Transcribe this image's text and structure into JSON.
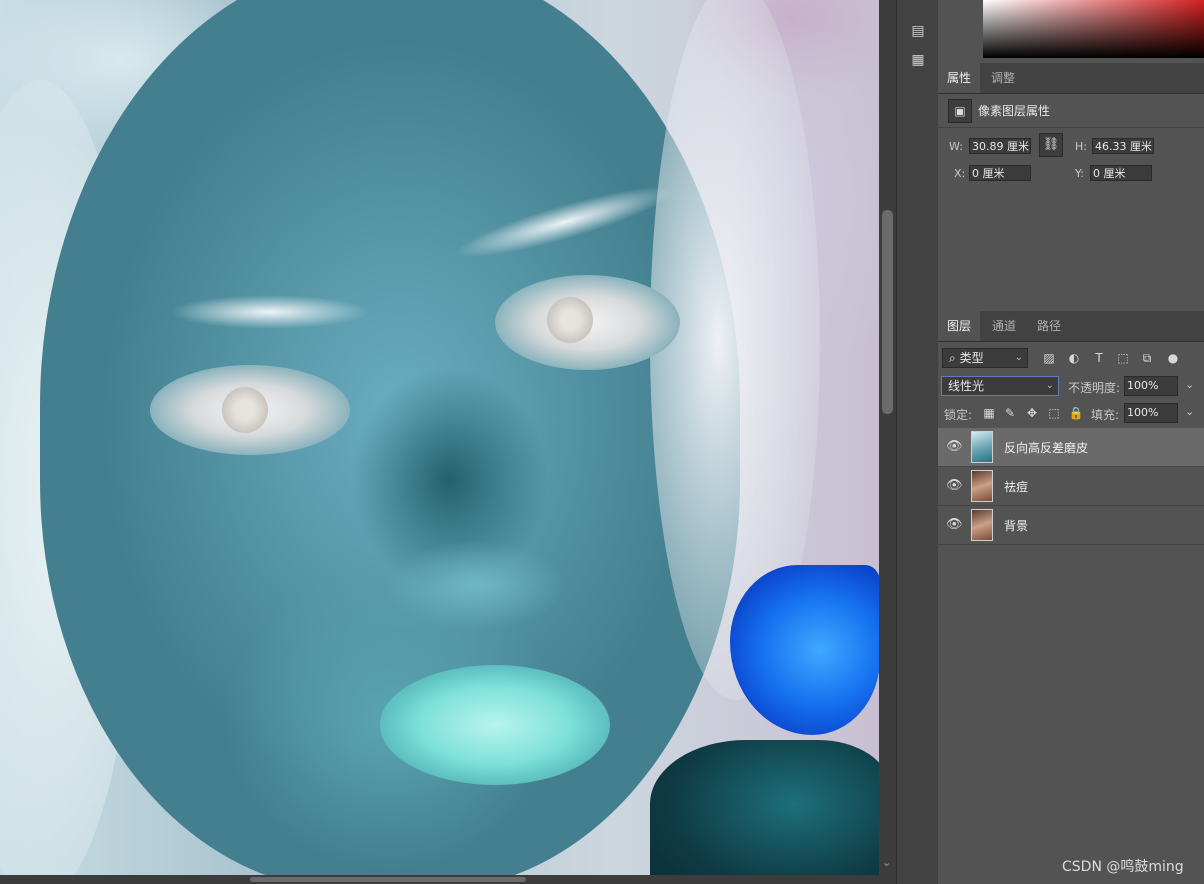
{
  "properties_panel": {
    "tabs": [
      "属性",
      "调整"
    ],
    "header_title": "像素图层属性",
    "width_label": "W:",
    "width_value": "30.89 厘米",
    "height_label": "H:",
    "height_value": "46.33 厘米",
    "x_label": "X:",
    "x_value": "0 厘米",
    "y_label": "Y:",
    "y_value": "0 厘米"
  },
  "layers_panel": {
    "tabs": [
      "图层",
      "通道",
      "路径"
    ],
    "filter_kind": "类型",
    "blend_mode": "线性光",
    "opacity_label": "不透明度:",
    "opacity_value": "100%",
    "lock_label": "锁定:",
    "fill_label": "填充:",
    "fill_value": "100%",
    "layers": [
      {
        "name": "反向高反差磨皮",
        "selected": true
      },
      {
        "name": "祛痘",
        "selected": false
      },
      {
        "name": "背景",
        "selected": false
      }
    ]
  },
  "watermark": "CSDN @鸣鼓ming"
}
